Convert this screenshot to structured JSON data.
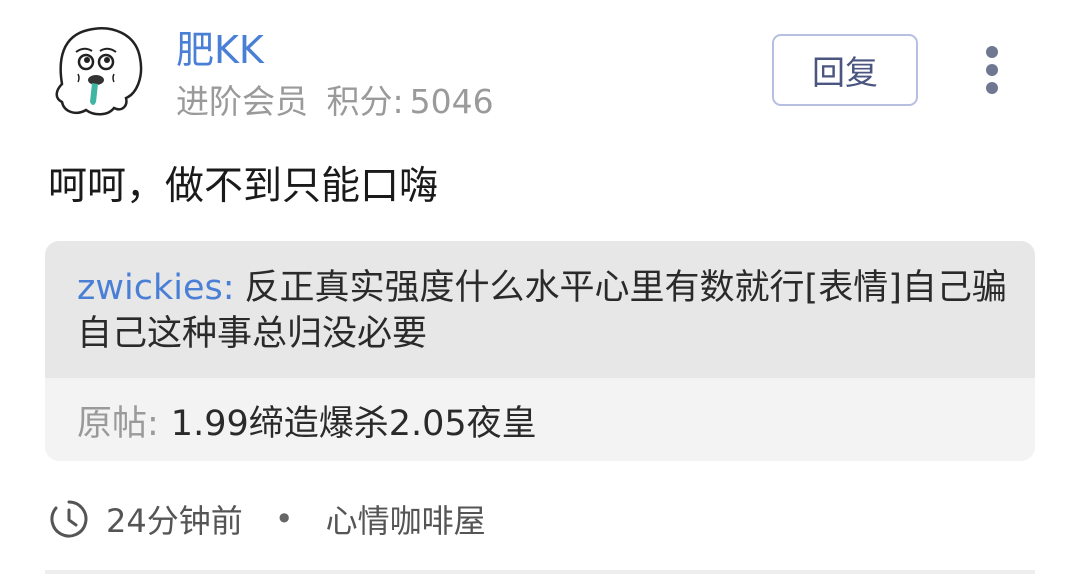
{
  "post": {
    "author": {
      "name": "肥KK",
      "level": "进阶会员",
      "score_label": "积分:",
      "score_value": "5046",
      "avatar_icon": "cartoon-face-avatar"
    },
    "reply_button_label": "回复",
    "more_icon": "vertical-ellipsis-icon",
    "comment": "呵呵，做不到只能口嗨",
    "quote": {
      "author": "zwickies:",
      "text": "反正真实强度什么水平心里有数就行[表情]自己骗自己这种事总归没必要"
    },
    "origin": {
      "label": "原帖:",
      "title": "1.99缔造爆杀2.05夜皇"
    },
    "footer": {
      "time_icon": "clock-icon",
      "time": "24分钟前",
      "separator": "•",
      "forum": "心情咖啡屋"
    }
  },
  "colors": {
    "accent_blue": "#4a7fd6",
    "muted_gray": "#9a9a9a",
    "quote_bg": "#e7e7e7",
    "origin_bg": "#f3f3f3",
    "button_border": "#b7bfe0"
  }
}
